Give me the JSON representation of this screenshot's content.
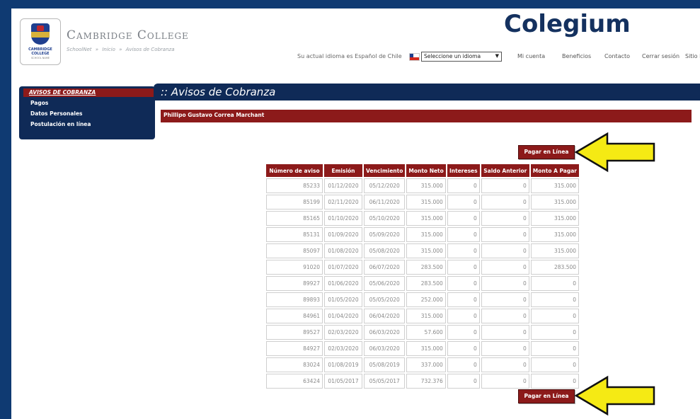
{
  "app": {
    "brand_logo_text": "Colegium",
    "college_name": "Cambridge College",
    "logo_text": "CAMBRIDGE COLLEGE",
    "logo_subtext": "SCHOOL NAME"
  },
  "breadcrumb": [
    "SchoolNet",
    "»",
    "Inicio",
    "»",
    "Avisos de Cobranza"
  ],
  "topnav": {
    "language_text": "Su actual idioma es Español de Chile",
    "language_select_value": "Seleccione un idioma",
    "links": [
      "Mi cuenta",
      "Beneficios",
      "Contacto",
      "Cerrar sesión",
      "Sitio Nue"
    ]
  },
  "sidebar": {
    "active_item": "AVISOS DE COBRANZA",
    "items": [
      "Pagos",
      "Datos Personales",
      "Postulación en línea"
    ]
  },
  "main": {
    "title": ":: Avisos de Cobranza",
    "student_name": "Phillipo Gustavo Correa Marchant",
    "pay_button_label": "Pagar en Línea"
  },
  "table": {
    "headers": [
      "Número de aviso",
      "Emisión",
      "Vencimiento",
      "Monto Neto",
      "Intereses",
      "Saldo Anterior",
      "Monto A Pagar"
    ],
    "rows": [
      [
        "85233",
        "01/12/2020",
        "05/12/2020",
        "315.000",
        "0",
        "0",
        "315.000"
      ],
      [
        "85199",
        "02/11/2020",
        "06/11/2020",
        "315.000",
        "0",
        "0",
        "315.000"
      ],
      [
        "85165",
        "01/10/2020",
        "05/10/2020",
        "315.000",
        "0",
        "0",
        "315.000"
      ],
      [
        "85131",
        "01/09/2020",
        "05/09/2020",
        "315.000",
        "0",
        "0",
        "315.000"
      ],
      [
        "85097",
        "01/08/2020",
        "05/08/2020",
        "315.000",
        "0",
        "0",
        "315.000"
      ],
      [
        "91020",
        "01/07/2020",
        "06/07/2020",
        "283.500",
        "0",
        "0",
        "283.500"
      ],
      [
        "89927",
        "01/06/2020",
        "05/06/2020",
        "283.500",
        "0",
        "0",
        "0"
      ],
      [
        "89893",
        "01/05/2020",
        "05/05/2020",
        "252.000",
        "0",
        "0",
        "0"
      ],
      [
        "84961",
        "01/04/2020",
        "06/04/2020",
        "315.000",
        "0",
        "0",
        "0"
      ],
      [
        "89527",
        "02/03/2020",
        "06/03/2020",
        "57.600",
        "0",
        "0",
        "0"
      ],
      [
        "84927",
        "02/03/2020",
        "06/03/2020",
        "315.000",
        "0",
        "0",
        "0"
      ],
      [
        "83024",
        "01/08/2019",
        "05/08/2019",
        "337.000",
        "0",
        "0",
        "0"
      ],
      [
        "63424",
        "01/05/2017",
        "05/05/2017",
        "732.376",
        "0",
        "0",
        "0"
      ]
    ]
  },
  "colors": {
    "navy": "#0f2a57",
    "maroon": "#8c1a1a",
    "arrow_yellow": "#f5ea14"
  }
}
